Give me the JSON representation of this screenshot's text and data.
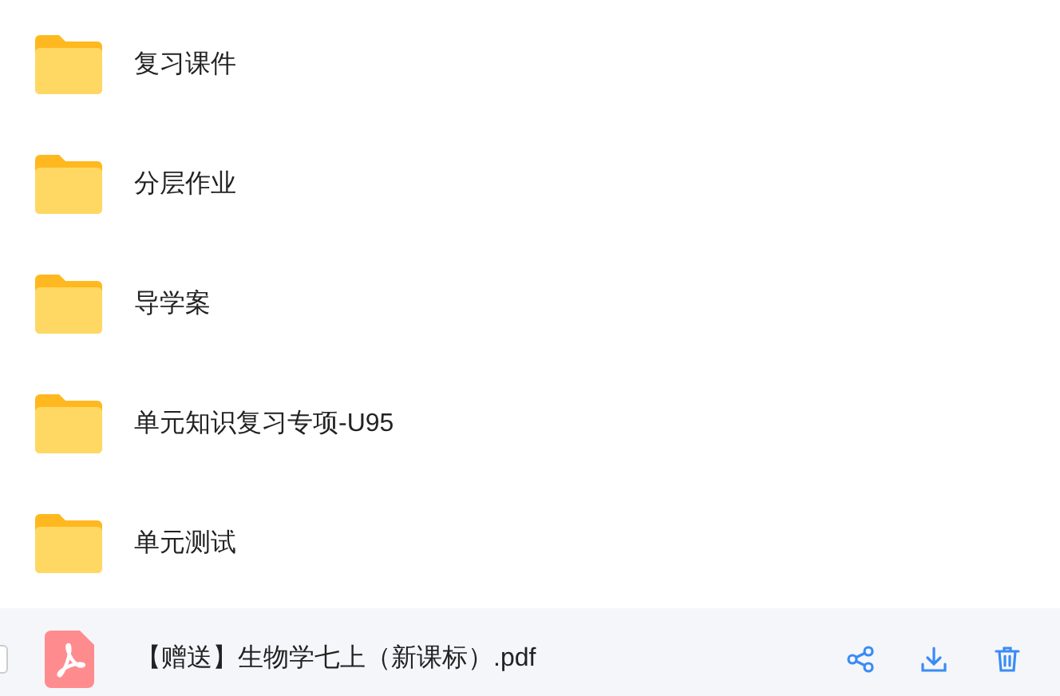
{
  "folders": [
    {
      "name": "复习课件"
    },
    {
      "name": "分层作业"
    },
    {
      "name": "导学案"
    },
    {
      "name": "单元知识复习专项-U95"
    },
    {
      "name": "单元测试"
    }
  ],
  "file": {
    "name": "【赠送】生物学七上（新课标）.pdf",
    "checked": false,
    "kind": "pdf"
  }
}
